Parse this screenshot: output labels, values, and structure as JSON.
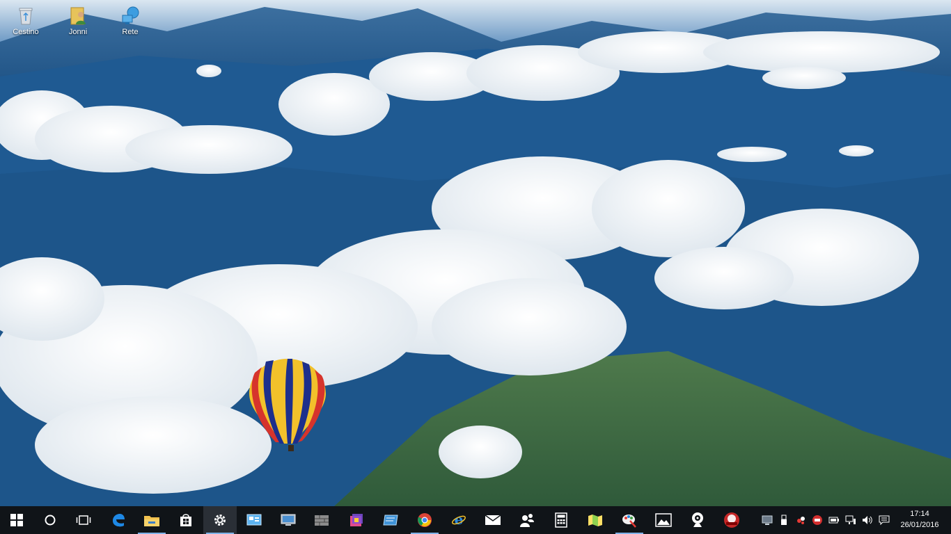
{
  "desktop": {
    "icons": [
      {
        "label": "Cestino",
        "icon": "recycle-bin-icon"
      },
      {
        "label": "Jonni",
        "icon": "user-folder-icon"
      },
      {
        "label": "Rete",
        "icon": "network-icon"
      }
    ]
  },
  "taskbar": {
    "start": "windows-logo-icon",
    "search": "cortana-circle-icon",
    "task_view": "task-view-icon",
    "pinned": [
      "edge-icon",
      "file-explorer-icon",
      "store-icon",
      "settings-gear-icon",
      "control-panel-icon",
      "remote-desktop-icon",
      "firewall-icon",
      "colorful-app-icon",
      "screen-app-icon",
      "chrome-icon",
      "internet-explorer-icon",
      "mail-icon",
      "people-icon",
      "calculator-icon",
      "maps-icon",
      "paint-icon",
      "photos-icon",
      "webcam-icon",
      "red-badge-app-icon"
    ],
    "tray": [
      "monitor-tray-icon",
      "usb-tray-icon",
      "antivirus-tray-icon",
      "red-tray-icon",
      "battery-tray-icon",
      "network-tray-icon",
      "volume-tray-icon",
      "action-center-icon"
    ],
    "time": "17:14",
    "date": "26/01/2016"
  },
  "colors": {
    "taskbar_bg": "#101418",
    "accent_underline": "#7fb3e8"
  }
}
